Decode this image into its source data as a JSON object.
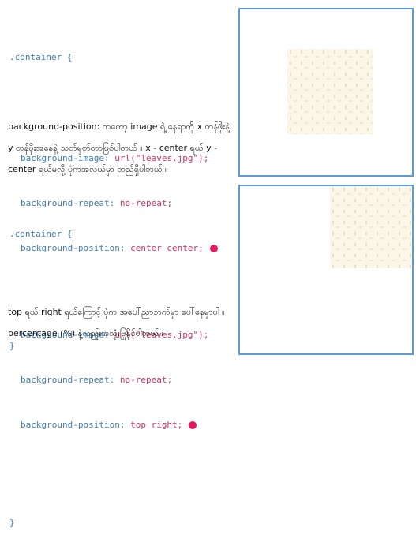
{
  "example1": {
    "selector": ".container {",
    "lines": [
      {
        "prop": "background-image:",
        "value": "url(\"leaves.jpg\");"
      },
      {
        "prop": "background-repeat:",
        "value": "no-repeat;"
      },
      {
        "prop": "background-position:",
        "value": "center center;"
      }
    ],
    "close": "}",
    "paragraph": "background-position: ကတော့ image ရဲ့ နေရာကို x တန်ဖိုးနဲ့ y တန်ဖိုးအနေနဲ့ သတ်မှတ်တာဖြစ်ပါတယ် ။ x - center ရယ် y - center ရယ်မလို့ ပုံကအလယ်မှာ တည်ရှိပါတယ် ။"
  },
  "example2": {
    "selector": ".container {",
    "lines": [
      {
        "prop": "background-image:",
        "value": "url(\"leaves.jpg\");"
      },
      {
        "prop": "background-repeat:",
        "value": "no-repeat;"
      },
      {
        "prop": "background-position:",
        "value": "top right;"
      }
    ],
    "close": "}",
    "paragraph": "top ရယ် right ရယ်ကြောင့် ပုံက အပေါ်ညာဘက်မှာ ပေါ်နေမှာပါ ။ percentage (%) နဲ့လည်းအသုံးပြုနိုင်ပါတယ် ။"
  },
  "colors": {
    "accent_dot": "#e5175f",
    "preview_border": "#5e9ad3"
  }
}
